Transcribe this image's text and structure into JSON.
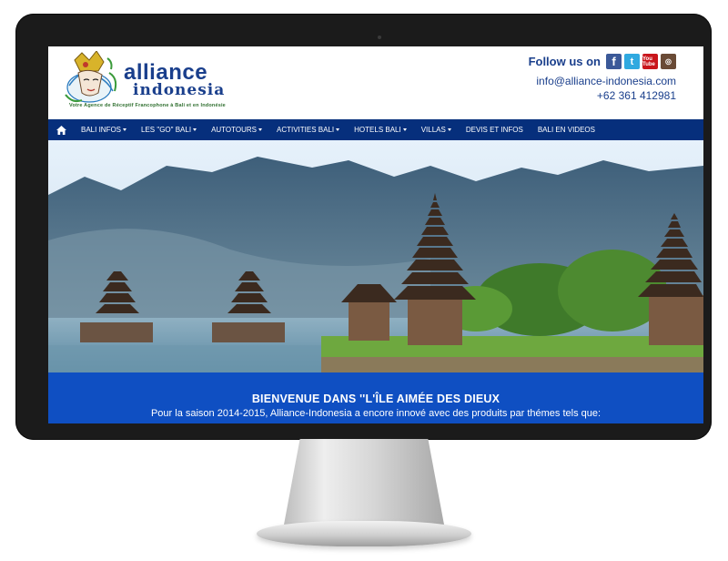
{
  "brand": {
    "name": "alliance",
    "subname": "indonesia",
    "tagline": "Votre Agence de Réceptif Francophone à Bali et en Indonésie"
  },
  "contact": {
    "follow_label": "Follow us on",
    "social": [
      {
        "name": "facebook",
        "glyph": "f"
      },
      {
        "name": "twitter",
        "glyph": "t"
      },
      {
        "name": "youtube",
        "glyph": "You Tube"
      },
      {
        "name": "instagram",
        "glyph": "◎"
      }
    ],
    "email": "info@alliance-indonesia.com",
    "phone": "+62 361 412981"
  },
  "nav": {
    "home_icon": "home-icon",
    "items": [
      {
        "label": "BALI INFOS",
        "dropdown": true
      },
      {
        "label": "LES \"GO\" BALI",
        "dropdown": true
      },
      {
        "label": "AUTOTOURS",
        "dropdown": true
      },
      {
        "label": "ACTIVITIES BALI",
        "dropdown": true
      },
      {
        "label": "HOTELS BALI",
        "dropdown": true
      },
      {
        "label": "VILLAS",
        "dropdown": true
      },
      {
        "label": "DEVIS ET INFOS",
        "dropdown": false
      },
      {
        "label": "BALI EN VIDEOS",
        "dropdown": false
      }
    ]
  },
  "welcome": {
    "title": "BIENVENUE DANS ''L'ÎLE AIMÉE DES DIEUX",
    "text": "Pour la saison 2014-2015, Alliance-Indonesia a encore innové avec des produits par thémes tels que:"
  },
  "colors": {
    "nav_bg": "#062f7c",
    "welcome_bg": "#0f4fc2",
    "brand_blue": "#1a3f8c"
  }
}
